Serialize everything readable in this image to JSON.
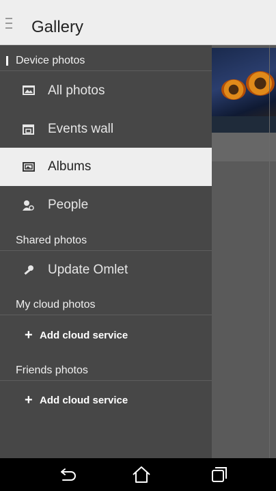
{
  "app": {
    "title": "Gallery"
  },
  "drawer": {
    "device_header": "Device photos",
    "device_items": [
      {
        "label": "All photos",
        "icon": "photo-icon"
      },
      {
        "label": "Events wall",
        "icon": "events-calendar-icon"
      },
      {
        "label": "Albums",
        "icon": "album-icon",
        "selected": true
      },
      {
        "label": "People",
        "icon": "people-icon"
      }
    ],
    "shared_header": "Shared photos",
    "shared_items": [
      {
        "label": "Update Omlet",
        "icon": "key-icon"
      }
    ],
    "cloud_header": "My cloud photos",
    "cloud_add": "Add cloud service",
    "friends_header": "Friends photos",
    "friends_add": "Add cloud service"
  },
  "navbar": {
    "buttons": [
      "back-icon",
      "home-icon",
      "recent-apps-icon"
    ]
  },
  "colors": {
    "selected_bg": "#eeeeee",
    "drawer_bg": "#474747",
    "appbar_bg": "#eeeeee"
  }
}
